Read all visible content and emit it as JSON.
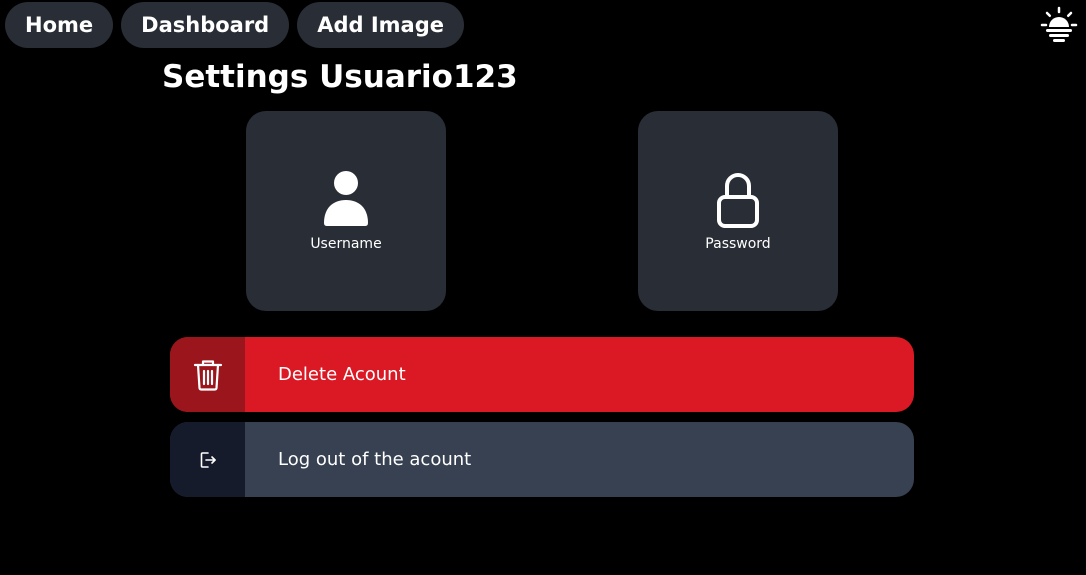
{
  "nav": {
    "home_label": "Home",
    "dashboard_label": "Dashboard",
    "add_image_label": "Add Image",
    "theme_icon": "sun-icon"
  },
  "page": {
    "title": "Settings Usuario123"
  },
  "cards": {
    "username": {
      "label": "Username",
      "icon": "user-icon"
    },
    "password": {
      "label": "Password",
      "icon": "lock-icon"
    }
  },
  "actions": {
    "delete": {
      "label": "Delete Acount",
      "icon": "trash-icon"
    },
    "logout": {
      "label": "Log out of the acount",
      "icon": "logout-icon"
    }
  },
  "colors": {
    "background": "#000000",
    "surface": "#292d35",
    "danger": "#db1924",
    "danger_dark": "#9b151c",
    "neutral": "#374151",
    "neutral_dark": "#151b2b"
  }
}
